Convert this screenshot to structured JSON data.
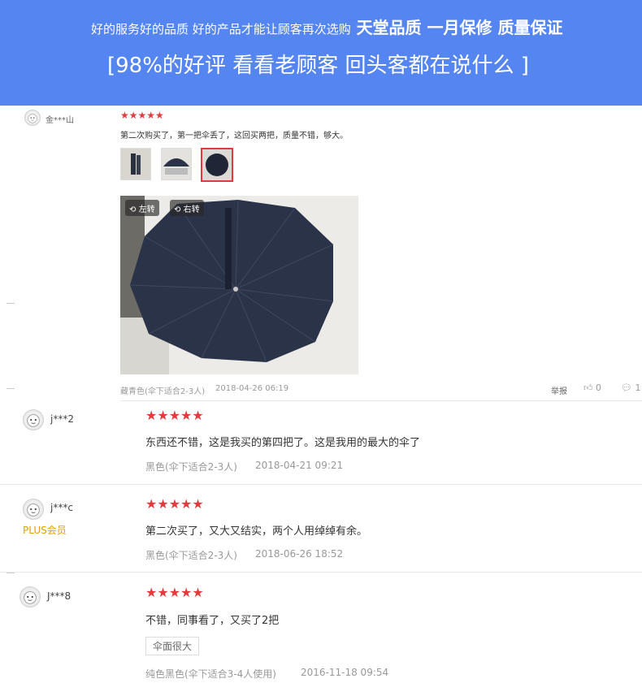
{
  "banner": {
    "line1_small": "好的服务好的品质 好的产品才能让顾客再次选购",
    "line1_big": "天堂品质 一月保修 质量保证",
    "line2": "[98%的好评 看看老顾客 回头客都在说什么 ]",
    "bg_color": "#5585f0"
  },
  "reviews": [
    {
      "user": "金***山",
      "stars": "★★★★★",
      "text": "第二次购买了，第一把伞丢了，这回买两把，质量不错，够大。",
      "variant": "藏青色(伞下适合2-3人)",
      "date": "2018-04-26 06:19",
      "report": "举报",
      "likes": "0",
      "comments": "1",
      "rotate_left": "左转",
      "rotate_right": "右转"
    },
    {
      "user": "j***2",
      "stars": "★★★★★",
      "text": "东西还不错，这是我买的第四把了。这是我用的最大的伞了",
      "variant": "黑色(伞下适合2-3人)",
      "date": "2018-04-21 09:21"
    },
    {
      "user": "j***c",
      "badge": "PLUS会员",
      "stars": "★★★★★",
      "text": "第二次买了，又大又结实，两个人用绰绰有余。",
      "variant": "黑色(伞下适合2-3人)",
      "date": "2018-06-26 18:52"
    },
    {
      "user": "J***8",
      "stars": "★★★★★",
      "text": "不错，同事看了，又买了2把",
      "tag": "伞面很大",
      "variant": "纯色黑色(伞下适合3-4人使用)",
      "date": "2016-11-18 09:54"
    }
  ],
  "colors": {
    "star": "#e33b3d",
    "plus_badge": "#e4a000",
    "selected_thumb": "#e4393c"
  },
  "icons": [
    "avatar-face-icon",
    "rotate-left-icon",
    "rotate-right-icon",
    "thumbs-up-icon",
    "comment-icon"
  ]
}
